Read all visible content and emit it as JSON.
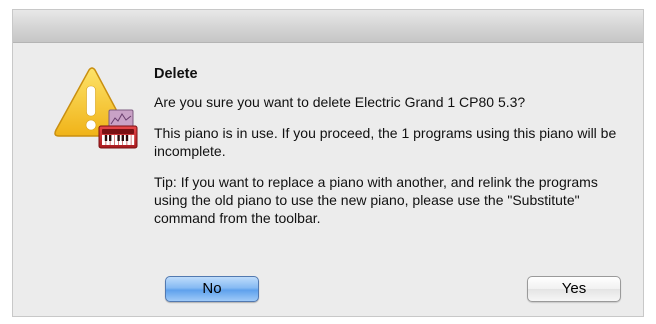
{
  "dialog": {
    "heading": "Delete",
    "question": "Are you sure you want to delete Electric Grand 1 CP80  5.3?",
    "warning": "This piano is in use. If you proceed, the 1 programs using this piano will be incomplete.",
    "tip": "Tip: If you want to replace a piano with another, and relink the programs using the old piano to use the new piano, please use the \"Substitute\" command from the toolbar.",
    "icon": "warning-triangle-with-keyboard-icon",
    "buttons": {
      "no_label": "No",
      "yes_label": "Yes"
    }
  },
  "colors": {
    "default_button": "#86baf3",
    "warning_yellow": "#f7c62c",
    "keyboard_red": "#c8262a"
  }
}
